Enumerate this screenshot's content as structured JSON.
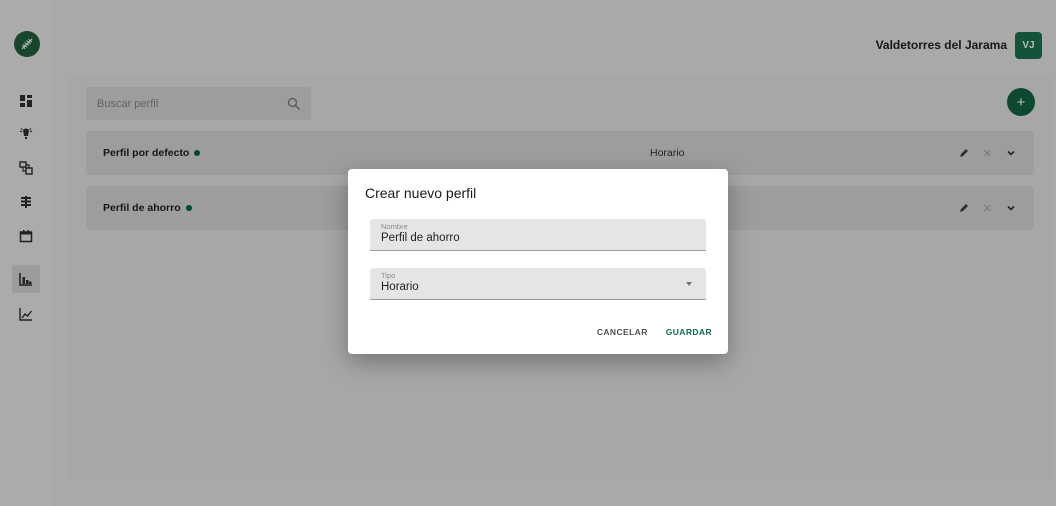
{
  "header": {
    "user_name": "Valdetorres del Jarama",
    "avatar_initials": "VJ"
  },
  "sidebar": {
    "items": [
      {
        "icon": "dashboard-icon"
      },
      {
        "icon": "lamp-icon"
      },
      {
        "icon": "network-icon"
      },
      {
        "icon": "layers-icon"
      },
      {
        "icon": "calendar-icon"
      },
      {
        "icon": "bar-chart-icon",
        "active": true
      },
      {
        "icon": "line-chart-icon"
      }
    ]
  },
  "main": {
    "search": {
      "placeholder": "Buscar perfil"
    },
    "add_label": "+",
    "profiles": [
      {
        "name": "Perfil por defecto",
        "type": "Horario"
      },
      {
        "name": "Perfil de ahorro",
        "type": ""
      }
    ]
  },
  "dialog": {
    "title": "Crear nuevo perfil",
    "name_field": {
      "label": "Nombre",
      "value": "Perfil de ahorro"
    },
    "type_field": {
      "label": "Tipo",
      "value": "Horario"
    },
    "cancel_label": "CANCELAR",
    "save_label": "GUARDAR"
  },
  "colors": {
    "accent": "#115e3e",
    "avatar": "#1a6a4a",
    "save": "#0e6e4a"
  }
}
